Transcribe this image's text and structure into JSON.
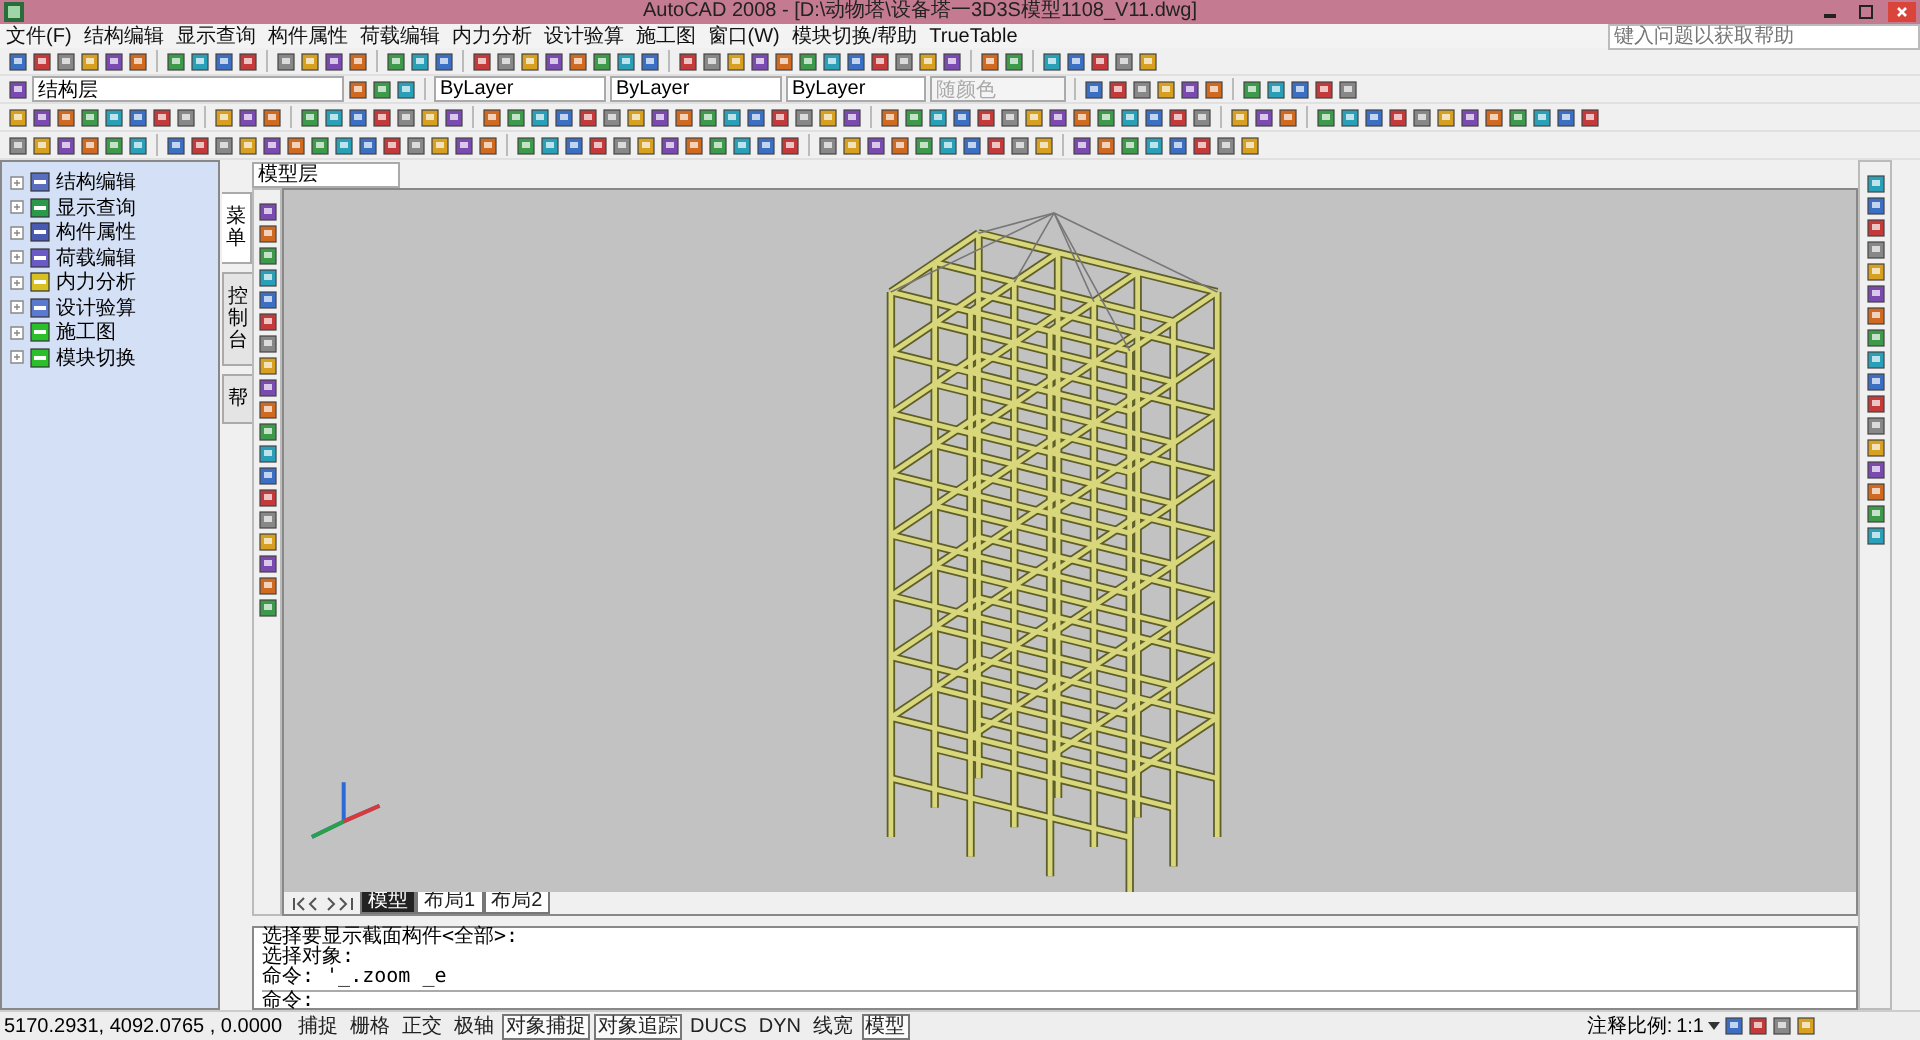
{
  "window": {
    "title": "AutoCAD 2008 - [D:\\动物塔\\设备塔一3D3S模型1108_V11.dwg]"
  },
  "menu": [
    "文件(F)",
    "结构编辑",
    "显示查询",
    "构件属性",
    "荷载编辑",
    "内力分析",
    "设计验算",
    "施工图",
    "窗口(W)",
    "模块切换/帮助",
    "TrueTable"
  ],
  "help_search": {
    "placeholder": "键入问题以获取帮助"
  },
  "properties_bar": {
    "layer": "结构层",
    "color_setting": "ByLayer",
    "linetype": "ByLayer",
    "lineweight": "ByLayer",
    "plot_style": {
      "value": "随颜色",
      "disabled": true
    }
  },
  "viewport_selector": "模型层",
  "tree": [
    {
      "label": "结构编辑"
    },
    {
      "label": "显示查询"
    },
    {
      "label": "构件属性"
    },
    {
      "label": "荷载编辑"
    },
    {
      "label": "内力分析"
    },
    {
      "label": "设计验算"
    },
    {
      "label": "施工图"
    },
    {
      "label": "模块切换"
    }
  ],
  "side_tabs": [
    {
      "label": "菜单",
      "selected": true
    },
    {
      "label": "控制台",
      "selected": false
    },
    {
      "label": "帮",
      "selected": false
    }
  ],
  "layout_tabs": [
    {
      "label": "模型",
      "selected": true
    },
    {
      "label": "布局1",
      "selected": false
    },
    {
      "label": "布局2",
      "selected": false
    }
  ],
  "command_history": [
    "选择要显示截面构件<全部>:",
    "选择对象:",
    "命令: '_.zoom _e"
  ],
  "command_prompt": "命令:",
  "status_bar": {
    "coordinates": "5170.2931, 4092.0765 , 0.0000",
    "toggles": [
      {
        "label": "捕捉",
        "on": false
      },
      {
        "label": "栅格",
        "on": false
      },
      {
        "label": "正交",
        "on": false
      },
      {
        "label": "极轴",
        "on": false
      },
      {
        "label": "对象捕捉",
        "on": true
      },
      {
        "label": "对象追踪",
        "on": true
      },
      {
        "label": "DUCS",
        "on": false
      },
      {
        "label": "DYN",
        "on": false
      },
      {
        "label": "线宽",
        "on": false
      },
      {
        "label": "模型",
        "on": true
      }
    ],
    "annotation_scale_label": "注释比例:",
    "annotation_scale": "1:1"
  }
}
